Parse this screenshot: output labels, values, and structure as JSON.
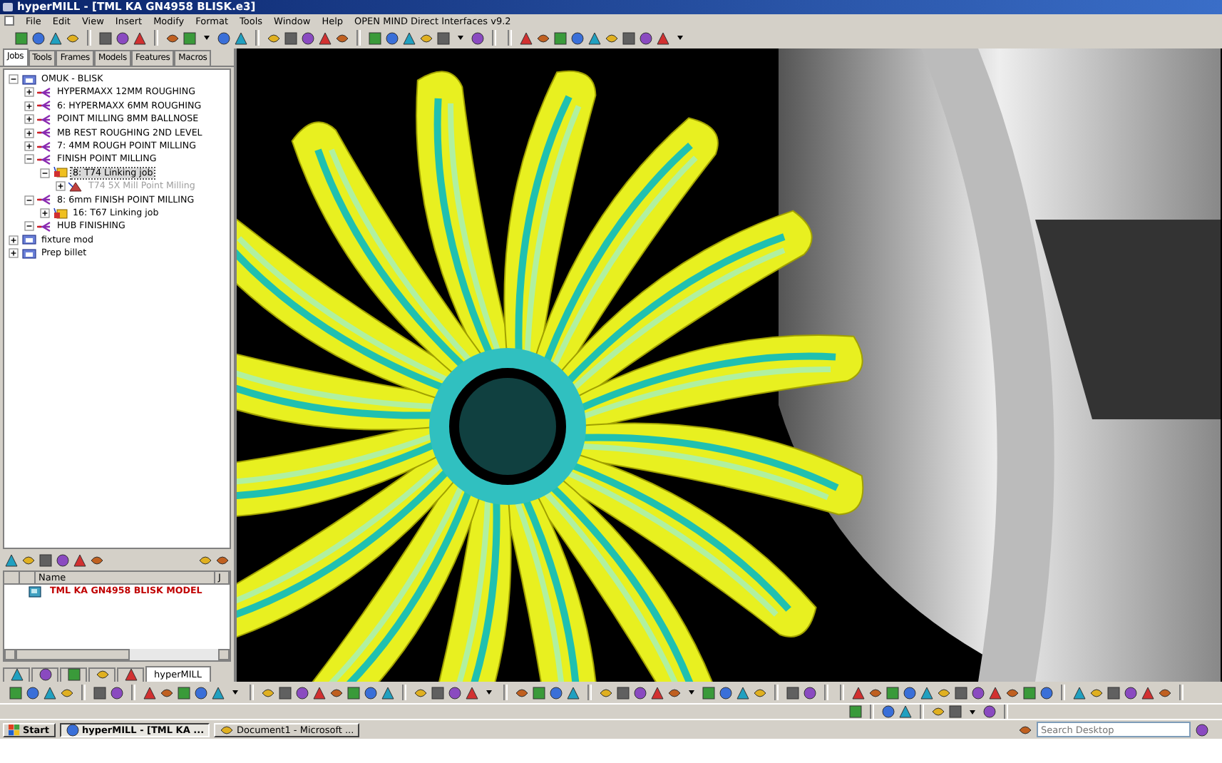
{
  "window": {
    "title": "hyperMILL - [TML KA GN4958 BLISK.e3]"
  },
  "menu": [
    "File",
    "Edit",
    "View",
    "Insert",
    "Modify",
    "Format",
    "Tools",
    "Window",
    "Help",
    "OPEN MIND Direct Interfaces v9.2"
  ],
  "browser_tabs": [
    {
      "label": "Jobs",
      "selected": true
    },
    {
      "label": "Tools",
      "selected": false
    },
    {
      "label": "Frames",
      "selected": false
    },
    {
      "label": "Models",
      "selected": false
    },
    {
      "label": "Features",
      "selected": false
    },
    {
      "label": "Macros",
      "selected": false
    }
  ],
  "job_tree": [
    {
      "label": "OMUK - BLISK",
      "kind": "folder",
      "expanded": true,
      "selected": false,
      "disabled": false,
      "children": [
        {
          "label": "HYPERMAXX 12MM ROUGHING",
          "kind": "list",
          "expanded": false,
          "selected": false,
          "disabled": false
        },
        {
          "label": "6: HYPERMAXX 6MM ROUGHING",
          "kind": "list",
          "expanded": false,
          "selected": false,
          "disabled": false
        },
        {
          "label": "POINT MILLING 8MM BALLNOSE",
          "kind": "list",
          "expanded": false,
          "selected": false,
          "disabled": false
        },
        {
          "label": "MB REST ROUGHING 2ND LEVEL",
          "kind": "list",
          "expanded": false,
          "selected": false,
          "disabled": false
        },
        {
          "label": "7: 4MM ROUGH POINT MILLING",
          "kind": "list",
          "expanded": false,
          "selected": false,
          "disabled": false
        },
        {
          "label": "FINISH POINT MILLING",
          "kind": "list",
          "expanded": true,
          "selected": false,
          "disabled": false,
          "children": [
            {
              "label": "8: T74 Linking job",
              "kind": "job",
              "expanded": true,
              "selected": true,
              "disabled": false,
              "children": [
                {
                  "label": "T74 5X Mill Point Milling",
                  "kind": "operation",
                  "expanded": false,
                  "selected": false,
                  "disabled": true
                }
              ]
            }
          ]
        },
        {
          "label": "8: 6mm FINISH POINT MILLING",
          "kind": "list",
          "expanded": true,
          "selected": false,
          "disabled": false,
          "children": [
            {
              "label": "16: T67 Linking job",
              "kind": "job",
              "expanded": false,
              "selected": false,
              "disabled": false
            }
          ]
        },
        {
          "label": "HUB FINISHING",
          "kind": "list",
          "expanded": true,
          "selected": false,
          "disabled": false
        }
      ]
    },
    {
      "label": "fixture mod",
      "kind": "folder",
      "expanded": false,
      "selected": false,
      "disabled": false
    },
    {
      "label": "Prep billet",
      "kind": "folder",
      "expanded": false,
      "selected": false,
      "disabled": false
    }
  ],
  "model_list": {
    "columns": [
      "Name",
      "J"
    ],
    "rows": [
      {
        "name": "TML KA GN4958 BLISK MODEL"
      }
    ]
  },
  "bottom_tabs": [
    {
      "kind": "icon",
      "selected": false
    },
    {
      "kind": "icon",
      "selected": false
    },
    {
      "kind": "icon",
      "selected": false
    },
    {
      "kind": "icon",
      "selected": false
    },
    {
      "kind": "icon",
      "selected": false
    },
    {
      "kind": "text",
      "label": "hyperMILL",
      "selected": true
    }
  ],
  "taskbar": {
    "start": "Start",
    "tasks": [
      {
        "label": "hyperMILL - [TML KA ...",
        "selected": true
      },
      {
        "label": "Document1 - Microsoft ...",
        "selected": false
      }
    ],
    "search": {
      "placeholder": "Search Desktop"
    }
  }
}
